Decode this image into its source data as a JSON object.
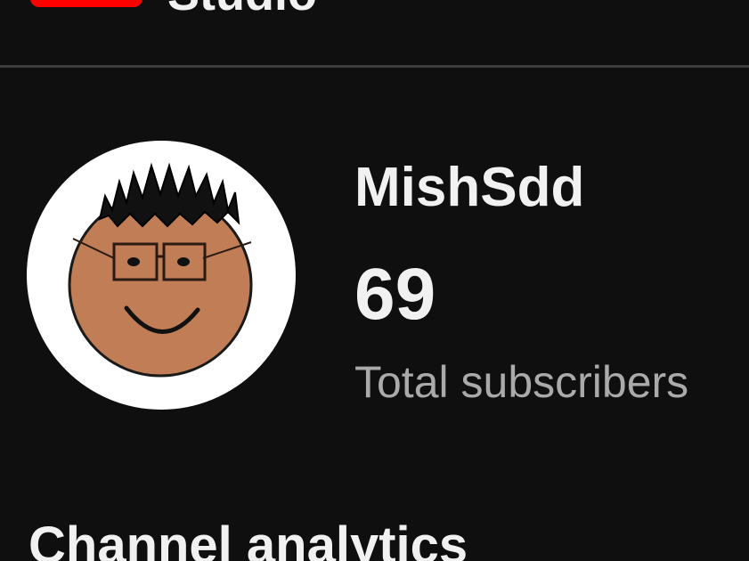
{
  "header": {
    "brand_icon": "youtube-logo-icon",
    "brand_color": "#ff0000",
    "title": "Studio"
  },
  "channel": {
    "name": "MishSdd",
    "subscriber_count": "69",
    "subscriber_label": "Total subscribers",
    "avatar_icon": "cartoon-face-avatar"
  },
  "sections": {
    "analytics_title": "Channel analytics"
  },
  "colors": {
    "background": "#0f0f0f",
    "text_primary": "#f1f1f1",
    "text_secondary": "#aaaaaa",
    "divider": "#3d3d3d",
    "avatar_skin": "#c17d55"
  }
}
